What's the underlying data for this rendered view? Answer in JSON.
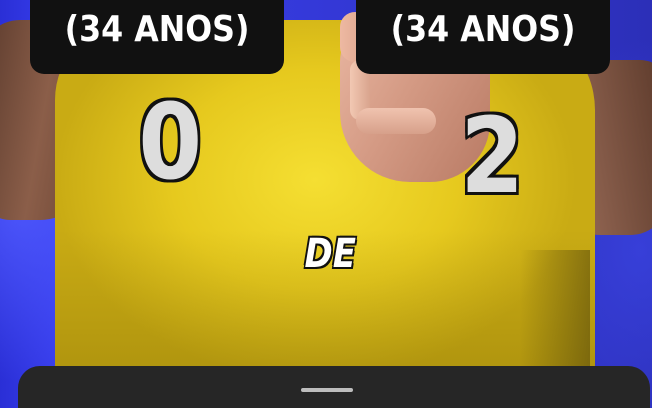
{
  "captions": {
    "left_label": "(34 ANOS)",
    "right_label": "(34 ANOS)",
    "left_number": "0",
    "right_number": "2",
    "center_word": "DE"
  },
  "colors": {
    "background": "#3a40f0",
    "shirt": "#f0d62a",
    "label_bg": "#111111",
    "number_fill": "#dddddd",
    "sheet_bg": "#262626"
  },
  "bottom_sheet": {
    "handle_icon": "drag-handle-icon"
  }
}
